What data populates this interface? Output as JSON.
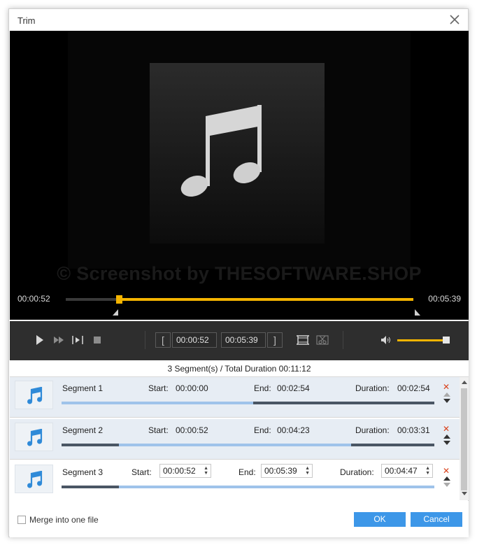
{
  "window": {
    "title": "Trim"
  },
  "player": {
    "watermark": "© Screenshot by THESOFTWARE.SHOP",
    "current_time": "00:00:52",
    "total_time": "00:05:39",
    "timeline": {
      "start_fraction": 0.153,
      "end_fraction": 1.0
    }
  },
  "controls": {
    "start_time": "00:00:52",
    "end_time": "00:05:39",
    "bracket_open": "[",
    "bracket_close": "]",
    "volume_fraction": 0.95
  },
  "summary": "3 Segment(s) / Total Duration 00:11:12",
  "segments": [
    {
      "name": "Segment 1",
      "start_label": "Start:",
      "start": "00:00:00",
      "end_label": "End:",
      "end": "00:02:54",
      "duration_label": "Duration:",
      "duration": "00:02:54",
      "bar": {
        "from": 0.0,
        "to": 0.515
      }
    },
    {
      "name": "Segment 2",
      "start_label": "Start:",
      "start": "00:00:52",
      "end_label": "End:",
      "end": "00:04:23",
      "duration_label": "Duration:",
      "duration": "00:03:31",
      "bar": {
        "from": 0.153,
        "to": 0.776
      }
    },
    {
      "name": "Segment 3",
      "start_label": "Start:",
      "start": "00:00:52",
      "end_label": "End:",
      "end": "00:05:39",
      "duration_label": "Duration:",
      "duration": "00:04:47",
      "bar": {
        "from": 0.153,
        "to": 1.0
      }
    }
  ],
  "footer": {
    "merge_label": "Merge into one file",
    "merge_checked": false,
    "ok_label": "OK",
    "cancel_label": "Cancel"
  },
  "colors": {
    "accent": "#f4b400",
    "button": "#3d97e8",
    "delete": "#d9421c",
    "segment_bar": "#9fc3ea"
  }
}
